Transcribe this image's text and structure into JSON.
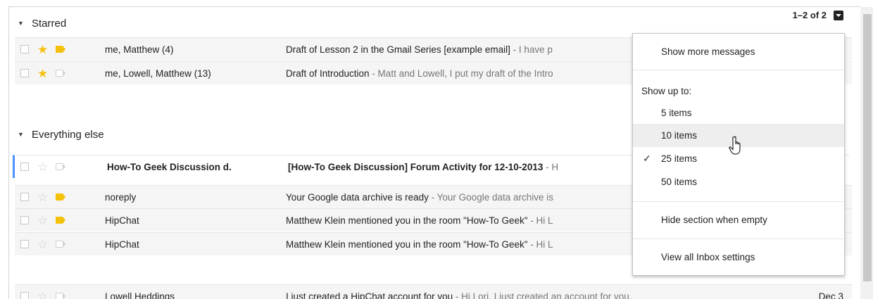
{
  "sections": {
    "starred": {
      "title": "Starred"
    },
    "everything_else": {
      "title": "Everything else"
    }
  },
  "pager": {
    "count": "1–2 of 2"
  },
  "starred_rows": [
    {
      "sender": "me, Matthew (4)",
      "subject": "Draft of Lesson 2 in the Gmail Series [example email]",
      "snippet": " - I have p",
      "starred": true,
      "label": "filled"
    },
    {
      "sender": "me, Lowell, Matthew (13)",
      "subject": "Draft of Introduction",
      "snippet": " - Matt and Lowell, I put my draft of the Intro",
      "starred": true,
      "label": "empty"
    }
  ],
  "other_rows": [
    {
      "sender": "How-To Geek Discussion d.",
      "subject": "[How-To Geek Discussion] Forum Activity for 12-10-2013",
      "snippet": " - H",
      "unread": true,
      "label": "empty"
    },
    {
      "sender": "noreply",
      "subject": "Your Google data archive is ready",
      "snippet": " - Your Google data archive is",
      "unread": false,
      "label": "filled"
    },
    {
      "sender": "HipChat",
      "subject": "Matthew Klein mentioned you in the room \"How-To Geek\"",
      "snippet": " - Hi L",
      "unread": false,
      "label": "filled"
    },
    {
      "sender": "HipChat",
      "subject": "Matthew Klein mentioned you in the room \"How-To Geek\"",
      "snippet": " - Hi L",
      "unread": false,
      "label": "empty"
    },
    {
      "sender": "Lowell Heddings",
      "subject": "I just created a HipChat account for you",
      "snippet": " - Hi Lori, I just created an account for you.",
      "unread": false,
      "label": "empty",
      "date": "Dec 3"
    }
  ],
  "dropdown": {
    "show_more": "Show more messages",
    "show_up_to": "Show up to:",
    "options": [
      "5 items",
      "10 items",
      "25 items",
      "50 items"
    ],
    "selected_option": "25 items",
    "hovered_option": "10 items",
    "hide_section": "Hide section when empty",
    "view_settings": "View all Inbox settings"
  },
  "colors": {
    "star": "#f4c20d",
    "label": "#f4c20d",
    "selected_bar": "#4d90fe"
  }
}
